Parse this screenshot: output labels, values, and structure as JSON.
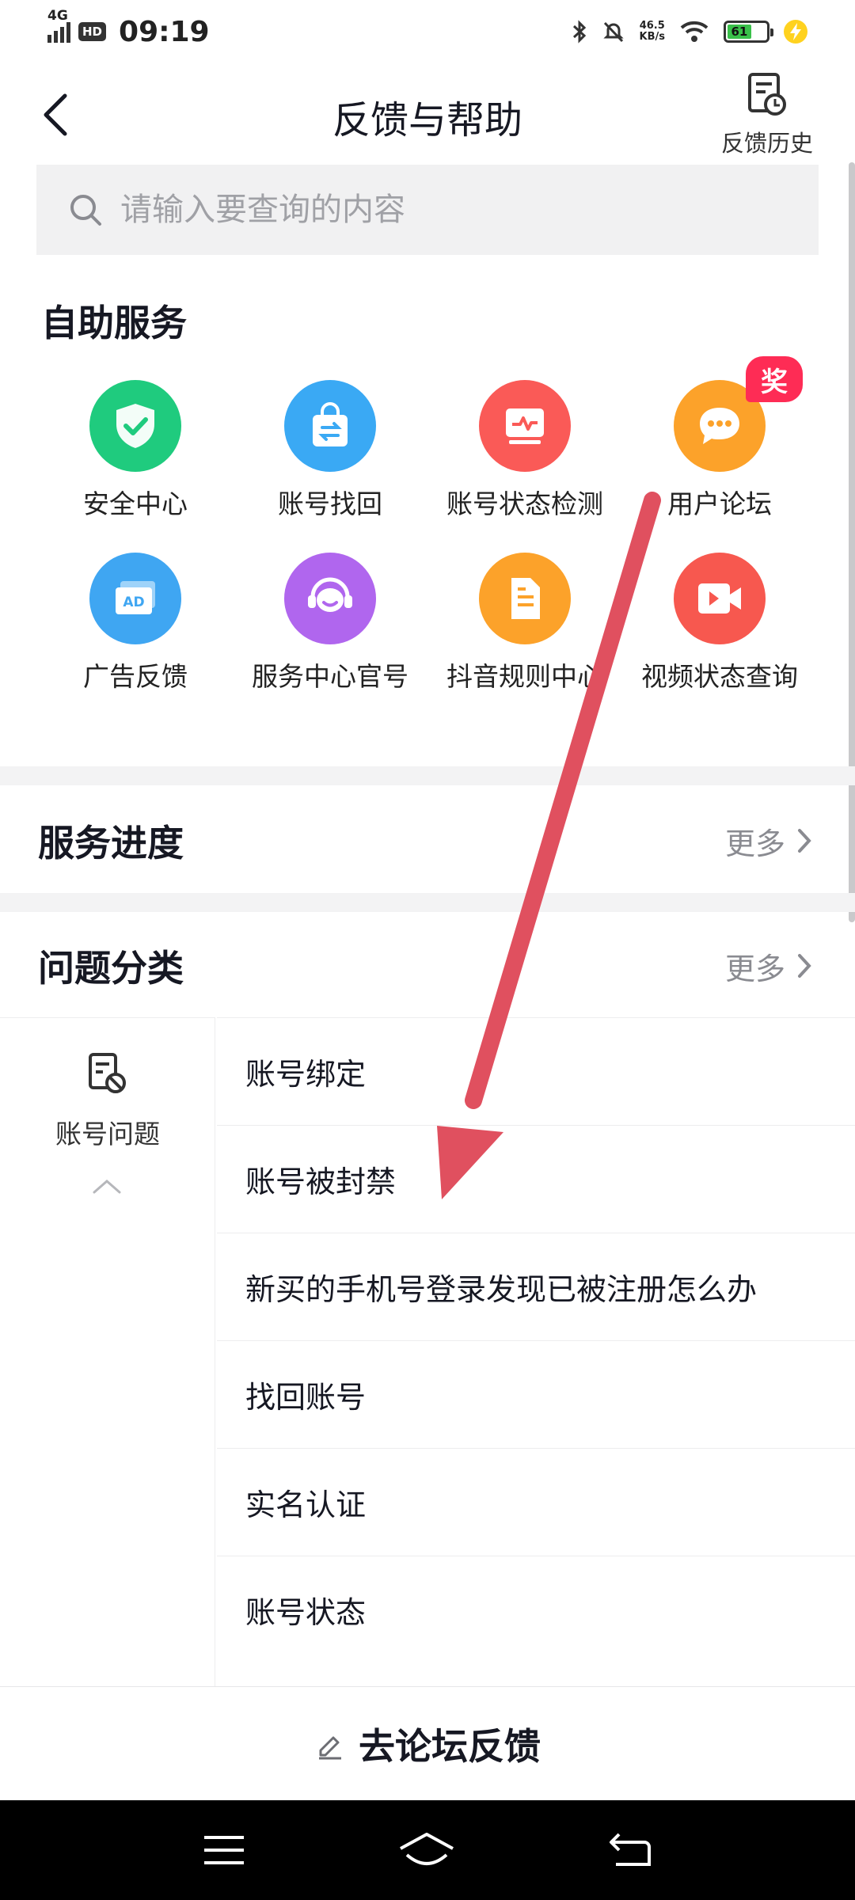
{
  "status_bar": {
    "network": "4G",
    "hd": "HD",
    "time": "09:19",
    "speed_value": "46.5",
    "speed_unit": "KB/s",
    "battery": "61"
  },
  "header": {
    "title": "反馈与帮助",
    "history_label": "反馈历史"
  },
  "search": {
    "placeholder": "请输入要查询的内容"
  },
  "self_service": {
    "title": "自助服务",
    "items": [
      {
        "label": "安全中心",
        "icon": "shield-check-icon",
        "color": "#1fcb7e"
      },
      {
        "label": "账号找回",
        "icon": "shopping-bag-swap-icon",
        "color": "#3aa9f4"
      },
      {
        "label": "账号状态检测",
        "icon": "monitor-pulse-icon",
        "color": "#fa5a57"
      },
      {
        "label": "用户论坛",
        "icon": "chat-bubble-icon",
        "color": "#fca22a",
        "badge": "奖"
      },
      {
        "label": "广告反馈",
        "icon": "ad-card-icon",
        "color": "#3fa6f2"
      },
      {
        "label": "服务中心官号",
        "icon": "headset-smile-icon",
        "color": "#b066ee"
      },
      {
        "label": "抖音规则中心",
        "icon": "document-icon",
        "color": "#fca22a"
      },
      {
        "label": "视频状态查询",
        "icon": "video-icon",
        "color": "#f7584f"
      }
    ]
  },
  "service_progress": {
    "title": "服务进度",
    "more": "更多"
  },
  "problem_category": {
    "title": "问题分类",
    "more": "更多",
    "selected": "账号问题",
    "items": [
      "账号绑定",
      "账号被封禁",
      "新买的手机号登录发现已被注册怎么办",
      "找回账号",
      "实名认证",
      "账号状态"
    ]
  },
  "bottom": {
    "forum_button": "去论坛反馈"
  },
  "colors": {
    "annotation_arrow": "#e0505f",
    "badge": "#fe2c55"
  }
}
